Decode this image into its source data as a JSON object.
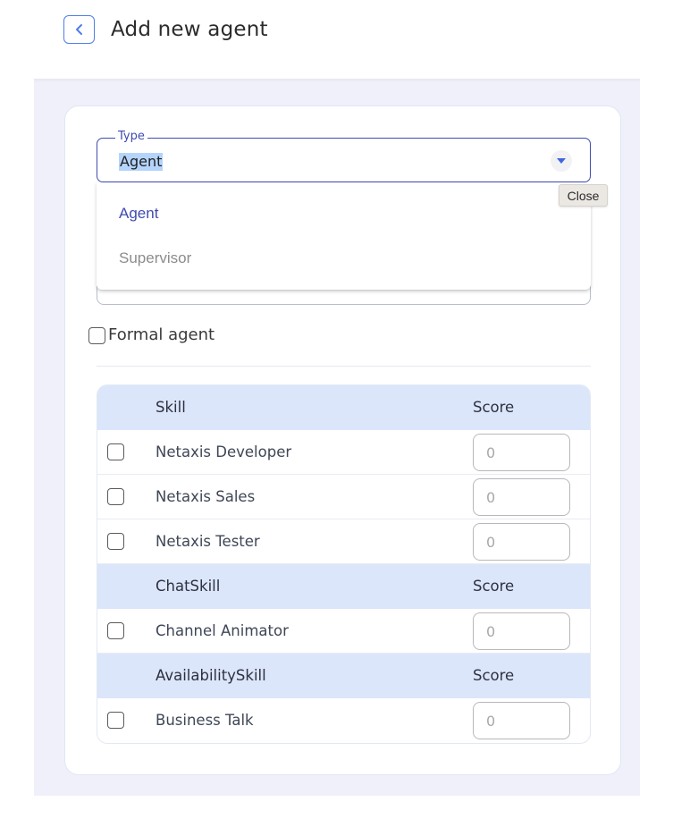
{
  "header": {
    "title": "Add new agent",
    "back_icon": "chevron-left-icon"
  },
  "form": {
    "type_field": {
      "label": "Type",
      "value": "Agent",
      "toggle_icon": "caret-down-icon"
    },
    "type_menu": {
      "options": [
        {
          "label": "Agent",
          "selected": true
        },
        {
          "label": "Supervisor",
          "selected": false
        }
      ]
    },
    "tooltip": "Close",
    "formal_agent": {
      "label": "Formal agent",
      "checked": false
    }
  },
  "skills": {
    "groups": [
      {
        "header": "Skill",
        "score_header": "Score",
        "rows": [
          {
            "name": "Netaxis Developer",
            "checked": false,
            "score": "",
            "placeholder": "0"
          },
          {
            "name": "Netaxis Sales",
            "checked": false,
            "score": "",
            "placeholder": "0"
          },
          {
            "name": "Netaxis Tester",
            "checked": false,
            "score": "",
            "placeholder": "0"
          }
        ]
      },
      {
        "header": "ChatSkill",
        "score_header": "Score",
        "rows": [
          {
            "name": "Channel Animator",
            "checked": false,
            "score": "",
            "placeholder": "0"
          }
        ]
      },
      {
        "header": "AvailabilitySkill",
        "score_header": "Score",
        "rows": [
          {
            "name": "Business Talk",
            "checked": false,
            "score": "",
            "placeholder": "0"
          }
        ]
      }
    ]
  },
  "colors": {
    "accent": "#3f4bb0",
    "back_button_border": "#4f7ee8",
    "table_header_bg": "#dce6fb",
    "page_bg": "#f0f0fa",
    "selection_highlight": "#b4d4fb"
  }
}
